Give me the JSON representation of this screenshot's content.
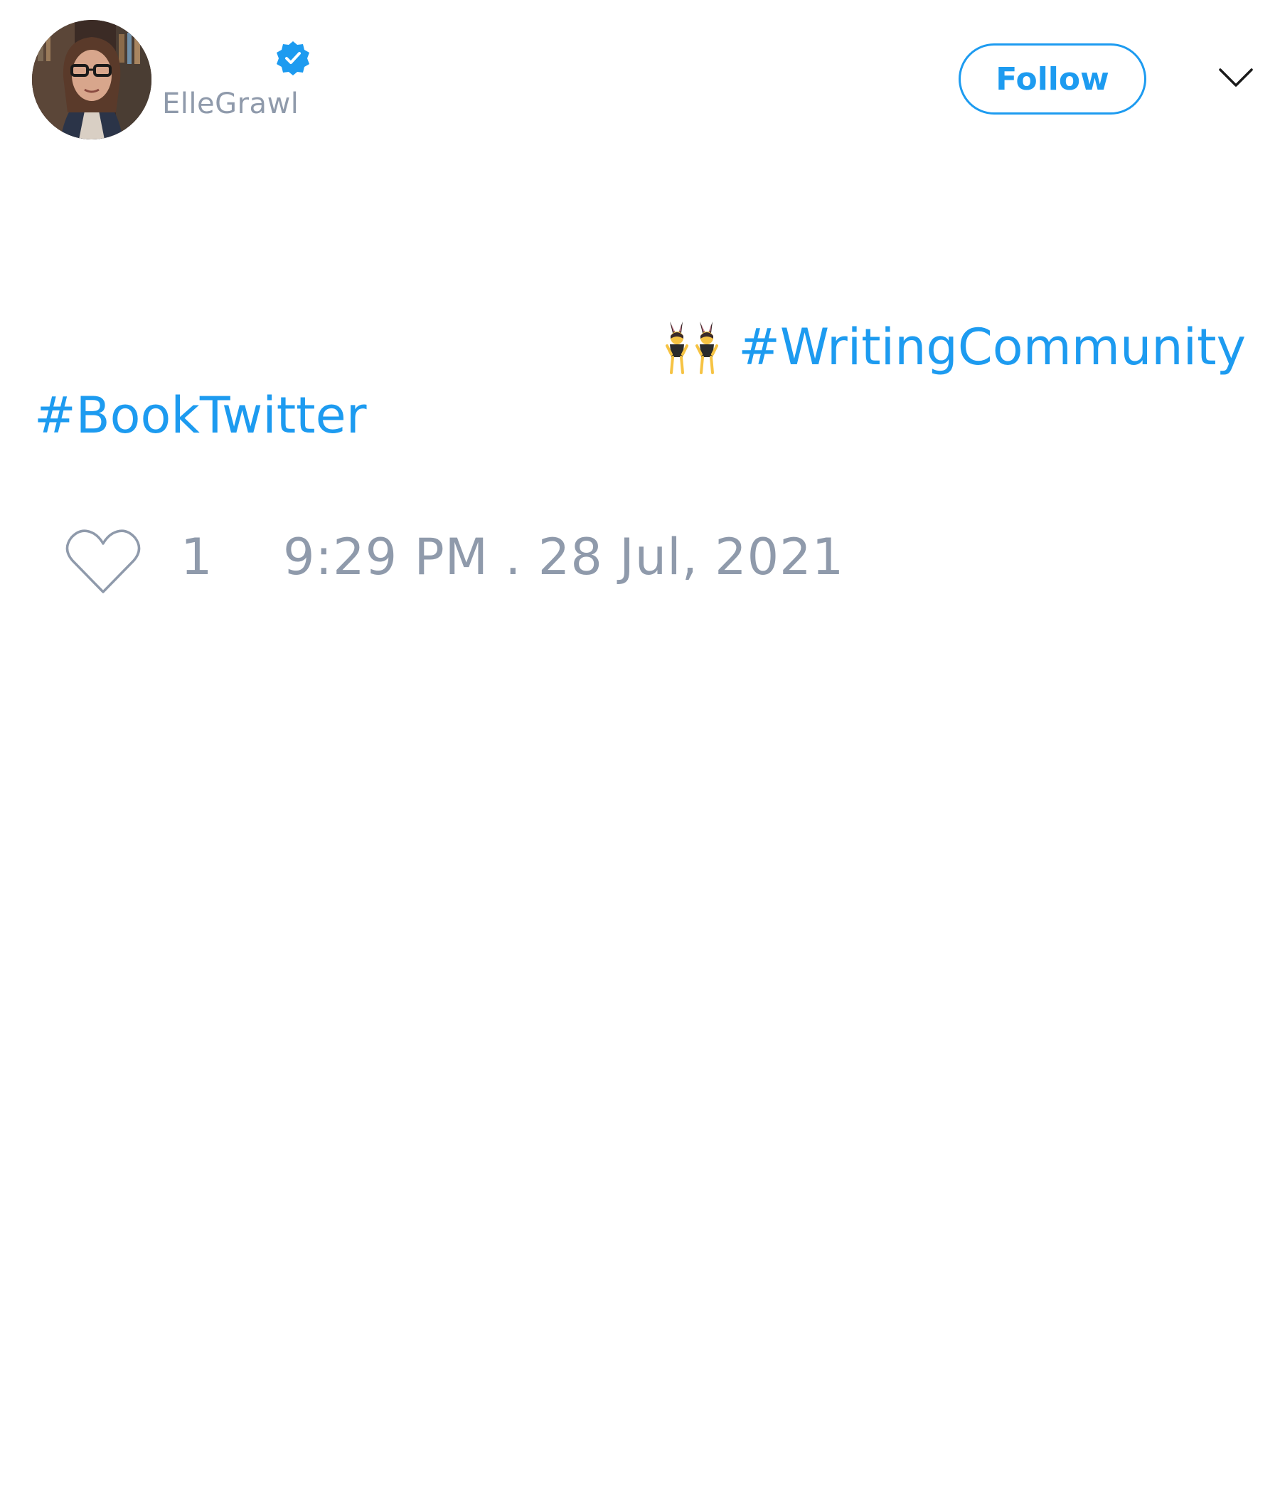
{
  "user": {
    "handle": "ElleGrawl",
    "verified_icon": "verified-badge-icon",
    "avatar_icon": "profile-photo"
  },
  "header": {
    "follow_label": "Follow",
    "menu_icon": "chevron-down-icon"
  },
  "tweet": {
    "emoji_icon": "women-with-bunny-ears-emoji",
    "hashtags": [
      "#WritingCommunity",
      "#BookTwitter"
    ]
  },
  "footer": {
    "like_icon": "heart-icon",
    "like_count": "1",
    "timestamp": "9:29 PM . 28 Jul, 2021"
  },
  "colors": {
    "accent": "#1d9bf0",
    "muted": "#8f9aab"
  }
}
